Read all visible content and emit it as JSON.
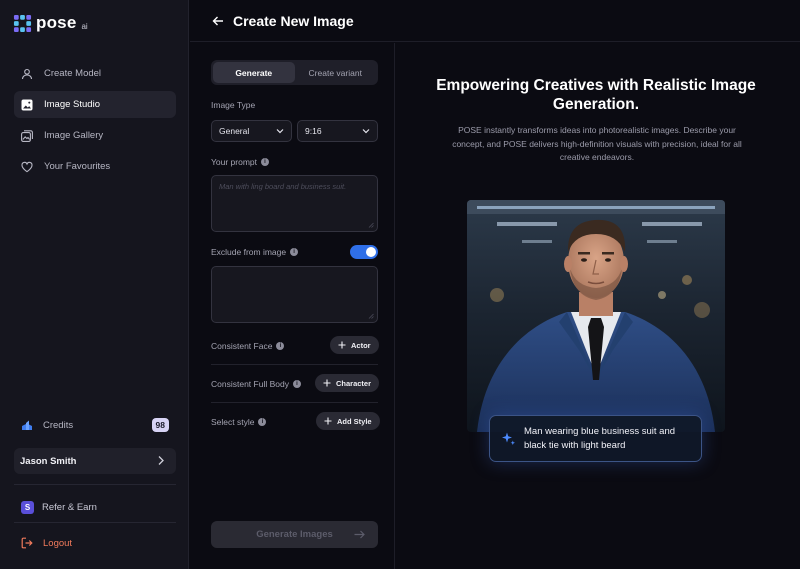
{
  "brand": {
    "name": "pose",
    "suffix": "ai",
    "accent": "#5a4fd9"
  },
  "sidebar": {
    "nav": [
      {
        "label": "Create Model",
        "icon": "user-icon"
      },
      {
        "label": "Image Studio",
        "icon": "image-icon",
        "active": true
      },
      {
        "label": "Image Gallery",
        "icon": "gallery-icon"
      },
      {
        "label": "Your Favourites",
        "icon": "heart-icon"
      }
    ],
    "credits": {
      "label": "Credits",
      "count": "98"
    },
    "user": {
      "name": "Jason Smith"
    },
    "refer": {
      "label": "Refer & Earn",
      "badge": "S"
    },
    "logout": {
      "label": "Logout",
      "color": "#f07a5c"
    }
  },
  "header": {
    "title": "Create New Image"
  },
  "form": {
    "tabs": [
      {
        "label": "Generate",
        "active": true
      },
      {
        "label": "Create variant",
        "active": false
      }
    ],
    "image_type": {
      "label": "Image Type",
      "type_value": "General",
      "ratio_value": "9:16"
    },
    "prompt": {
      "label": "Your prompt",
      "placeholder": "Man with ling board and business suit."
    },
    "exclude": {
      "label": "Exclude from image",
      "enabled": true,
      "placeholder": ""
    },
    "consistent_face": {
      "label": "Consistent Face",
      "button": "Actor"
    },
    "consistent_body": {
      "label": "Consistent Full Body",
      "button": "Character"
    },
    "style": {
      "label": "Select style",
      "button": "Add Style"
    },
    "generate_button": "Generate Images"
  },
  "preview": {
    "title": "Empowering Creatives with Realistic Image Generation.",
    "description": "POSE instantly transforms ideas into photorealistic images. Describe your concept, and POSE delivers high-definition visuals with precision, ideal for all creative endeavors.",
    "caption": "Man wearing blue business suit and black tie with light beard"
  }
}
